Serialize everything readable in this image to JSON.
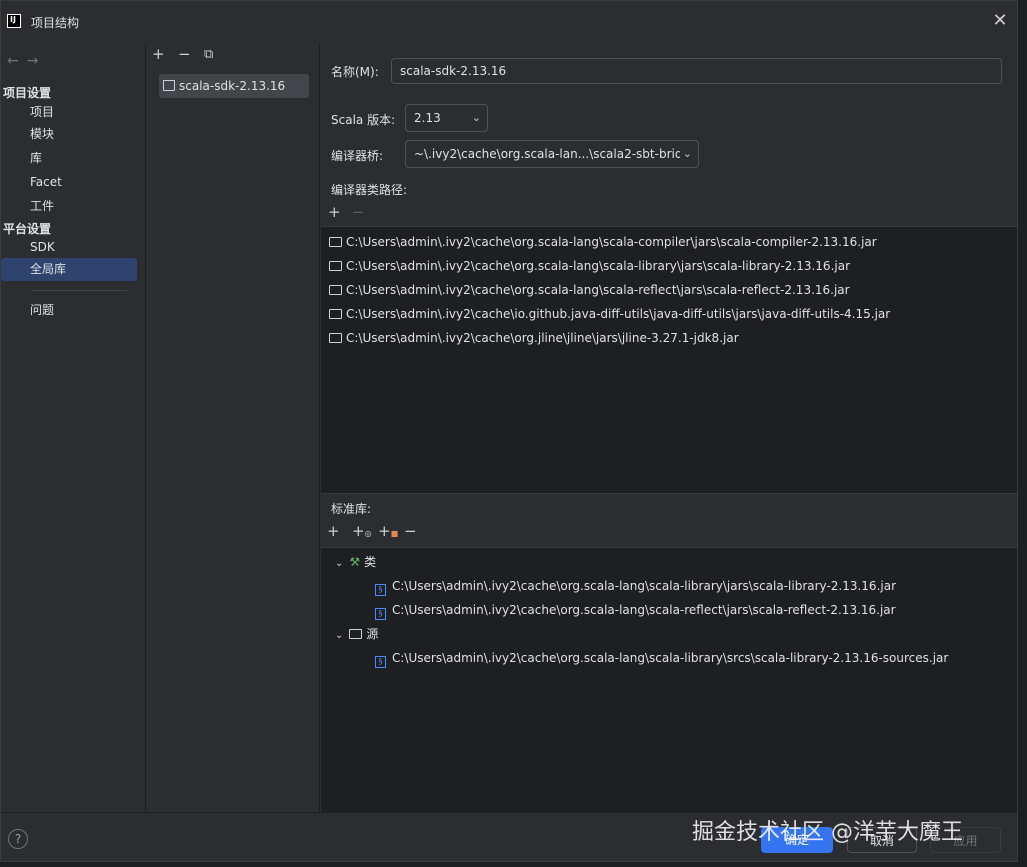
{
  "window": {
    "title": "项目结构",
    "logo": "IJ"
  },
  "nav": {
    "back": "←",
    "forward": "→",
    "project_settings_heading": "项目设置",
    "project_items": [
      "项目",
      "模块",
      "库",
      "Facet",
      "工件"
    ],
    "platform_settings_heading": "平台设置",
    "platform_items": [
      "SDK",
      "全局库"
    ],
    "problems": "问题"
  },
  "libraries": {
    "toolbar": [
      "+",
      "−",
      "⧉"
    ],
    "selected": "scala-sdk-2.13.16"
  },
  "form": {
    "name_label": "名称(M):",
    "name_value": "scala-sdk-2.13.16",
    "scala_version_label": "Scala 版本:",
    "scala_version_value": "2.13",
    "compiler_bridge_label": "编译器桥:",
    "compiler_bridge_value": "~\\.ivy2\\cache\\org.scala-lan...\\scala2-sbt-brid",
    "classpath_label": "编译器类路径:"
  },
  "classpath": [
    "C:\\Users\\admin\\.ivy2\\cache\\org.scala-lang\\scala-compiler\\jars\\scala-compiler-2.13.16.jar",
    "C:\\Users\\admin\\.ivy2\\cache\\org.scala-lang\\scala-library\\jars\\scala-library-2.13.16.jar",
    "C:\\Users\\admin\\.ivy2\\cache\\org.scala-lang\\scala-reflect\\jars\\scala-reflect-2.13.16.jar",
    "C:\\Users\\admin\\.ivy2\\cache\\io.github.java-diff-utils\\java-diff-utils\\jars\\java-diff-utils-4.15.jar",
    "C:\\Users\\admin\\.ivy2\\cache\\org.jline\\jline\\jars\\jline-3.27.1-jdk8.jar"
  ],
  "stdlib": {
    "label": "标准库:",
    "classes_label": "类",
    "classes": [
      "C:\\Users\\admin\\.ivy2\\cache\\org.scala-lang\\scala-library\\jars\\scala-library-2.13.16.jar",
      "C:\\Users\\admin\\.ivy2\\cache\\org.scala-lang\\scala-reflect\\jars\\scala-reflect-2.13.16.jar"
    ],
    "sources_label": "源",
    "sources": [
      "C:\\Users\\admin\\.ivy2\\cache\\org.scala-lang\\scala-library\\srcs\\scala-library-2.13.16-sources.jar"
    ]
  },
  "buttons": {
    "ok": "确定",
    "cancel": "取消",
    "apply": "应用",
    "help": "?"
  },
  "watermark": "掘金技术社区 @洋芋大魔王",
  "colors": {
    "accent": "#3574f0",
    "selection": "#2e436e",
    "background": "#2b2d30"
  }
}
